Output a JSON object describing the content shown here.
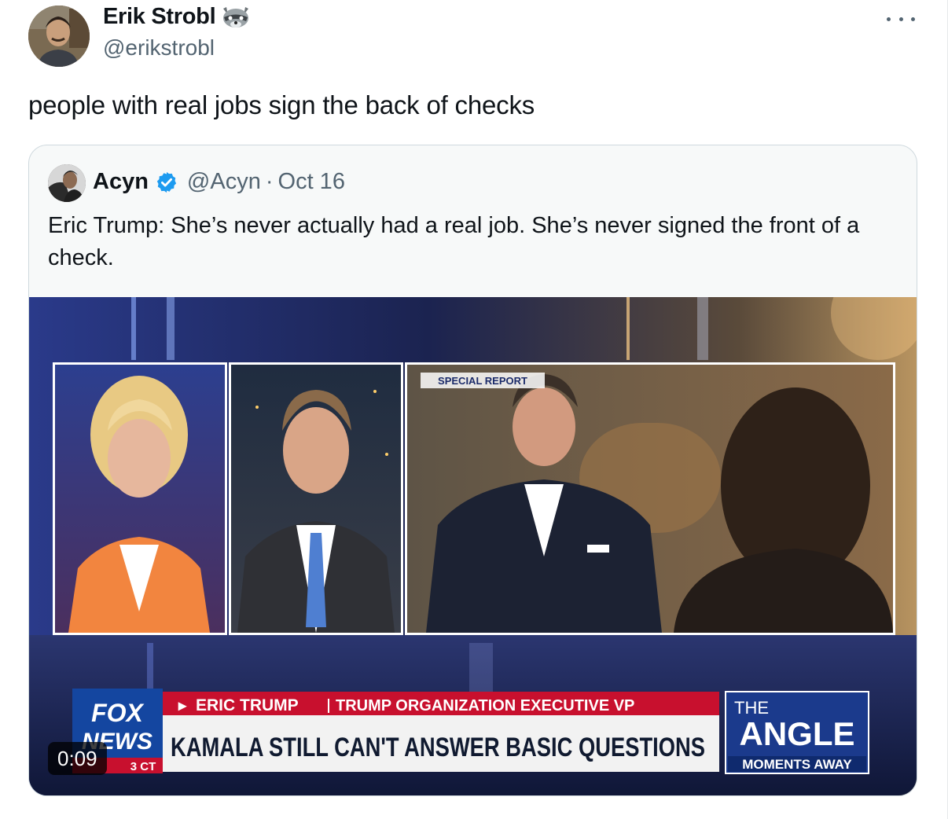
{
  "author": {
    "display_name": "Erik Strobl",
    "name_emoji": "raccoon-emoji",
    "handle": "@erikstrobl"
  },
  "tweet": {
    "text": "people with real jobs sign the back of checks"
  },
  "quoted_tweet": {
    "display_name": "Acyn",
    "verified": true,
    "handle": "@Acyn",
    "separator": "·",
    "date": "Oct 16",
    "text": "Eric Trump: She’s never actually had a real job. She’s never signed the front of a check."
  },
  "video": {
    "duration": "0:09",
    "special_report_tag": "SPECIAL REPORT",
    "network_logo_top": "FOX",
    "network_logo_bottom": "NEWS",
    "timezone_tag": "3 CT",
    "lower_third_name": "ERIC TRUMP",
    "lower_third_title": "TRUMP ORGANIZATION EXECUTIVE VP",
    "headline": "KAMALA STILL CAN'T ANSWER BASIC QUESTIONS",
    "show_prefix": "THE",
    "show_name": "ANGLE",
    "show_tagline": "MOMENTS AWAY"
  },
  "colors": {
    "text_primary": "#0f1419",
    "text_secondary": "#536471",
    "verified_blue": "#1d9bf0",
    "quote_border": "#cfd9de",
    "chyron_red": "#c8102e"
  }
}
